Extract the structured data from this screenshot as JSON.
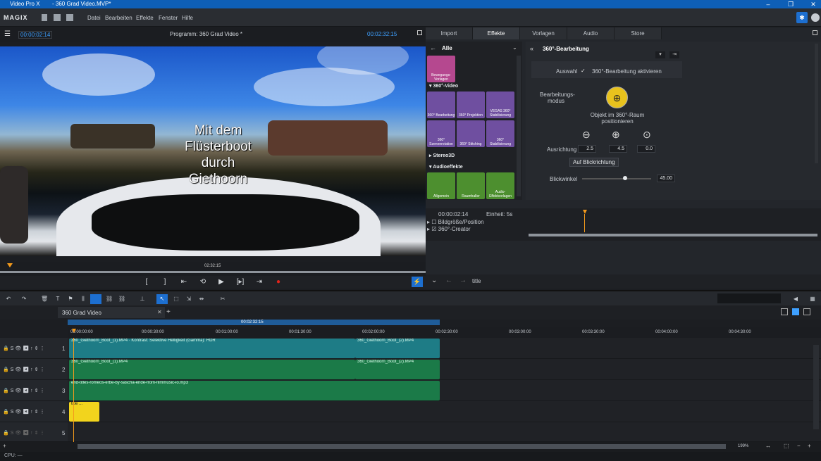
{
  "window": {
    "app_name": "Video Pro X",
    "document_title": "- 360 Grad Video.MVP*"
  },
  "menu": {
    "logo": "MAGIX",
    "items": [
      "Datei",
      "Bearbeiten",
      "Effekte",
      "Fenster",
      "Hilfe"
    ]
  },
  "program": {
    "timecode_left": "00:00:02:14",
    "title": "Programm: 360 Grad Video *",
    "timecode_right": "00:02:32:15"
  },
  "video": {
    "overlay_text": "Mit dem\nFlüsterboot\ndurch\nGiethoorn"
  },
  "scrubber": {
    "time": "02:32:15"
  },
  "transport": {
    "buttons": [
      "[",
      "]",
      "⇤",
      "⟲",
      "▶",
      "[▸]",
      "⇥",
      "●"
    ]
  },
  "right_tabs": [
    "Import",
    "Effekte",
    "Vorlagen",
    "Audio",
    "Store"
  ],
  "effects_browser": {
    "category": "Alle",
    "top_tile": "Bewegungs-Vorlagen",
    "section_360": "360°-Video",
    "tiles_360": [
      "360° Bearbeitung",
      "360° Projektion",
      "VEGAS 360° Stabilisierung",
      "360° Szenenrotation",
      "360° Stitching",
      "360° Stabilisierung"
    ],
    "section_stereo": "Stereo3D",
    "section_audio": "Audioeffekte",
    "audio_tiles": [
      "Allgemein",
      "Raumhaller",
      "Audio-Effektvorlagen"
    ]
  },
  "fx_panel": {
    "title": "360°-Bearbeitung",
    "auswahl_label": "Auswahl",
    "checkbox_label": "360°-Bearbeitung aktivieren",
    "mode_label": "Bearbeitungs-modus",
    "mode_desc": "Objekt im 360°-Raum positionieren",
    "ausrichtung_label": "Ausrichtung",
    "values": [
      "2.5",
      "4.5",
      "0.0"
    ],
    "blick_button": "Auf Blickrichtung",
    "blickwinkel_label": "Blickwinkel",
    "blickwinkel_value": "45.00",
    "blickwinkel_level": 0.62
  },
  "keyframes": {
    "timecode": "00:00:02:14",
    "einheit": "Einheit: 5s",
    "rows": [
      "Bildgröße/Position",
      "360°-Creator"
    ]
  },
  "bottom_bar": {
    "title_label": "title"
  },
  "timeline": {
    "tab_name": "360 Grad Video",
    "ruler_marker": "00:02:32:15",
    "ruler_ticks": [
      "00:00:00:00",
      "00:00:30:00",
      "00:01:00:00",
      "00:01:30:00",
      "00:02:00:00",
      "00:02:30:00",
      "00:03:00:00",
      "00:03:30:00",
      "00:04:00:00",
      "00:04:30:00"
    ],
    "track_numbers": [
      "1",
      "2",
      "3",
      "4",
      "5"
    ],
    "clips": {
      "t1a": "360_Giethoorn_Boot_(1).MP4 · Kontrast: Selektive Helligkeit (Gamma): HDR",
      "t1b": "360_Giethoorn_Boot_(2).MP4",
      "t2a": "360_Giethoorn_Boot_(1).MP4",
      "t2b": "360_Giethoorn_Boot_(2).MP4",
      "t3": "end-titles-romeos-erbe-by-sascha-ende-from-filmmusic-io.mp3",
      "t4": "title ..."
    },
    "zoom": "199%"
  },
  "status": {
    "cpu": "CPU: —"
  },
  "colors": {
    "accent": "#3ea0ff",
    "title_bar": "#0e5fb7",
    "video_clip": "#1e7c86",
    "audio_clip": "#1b7a48",
    "title_clip": "#f2d41d",
    "fx_tile": "#6f4fa0",
    "audio_tile": "#4d8f2f"
  }
}
